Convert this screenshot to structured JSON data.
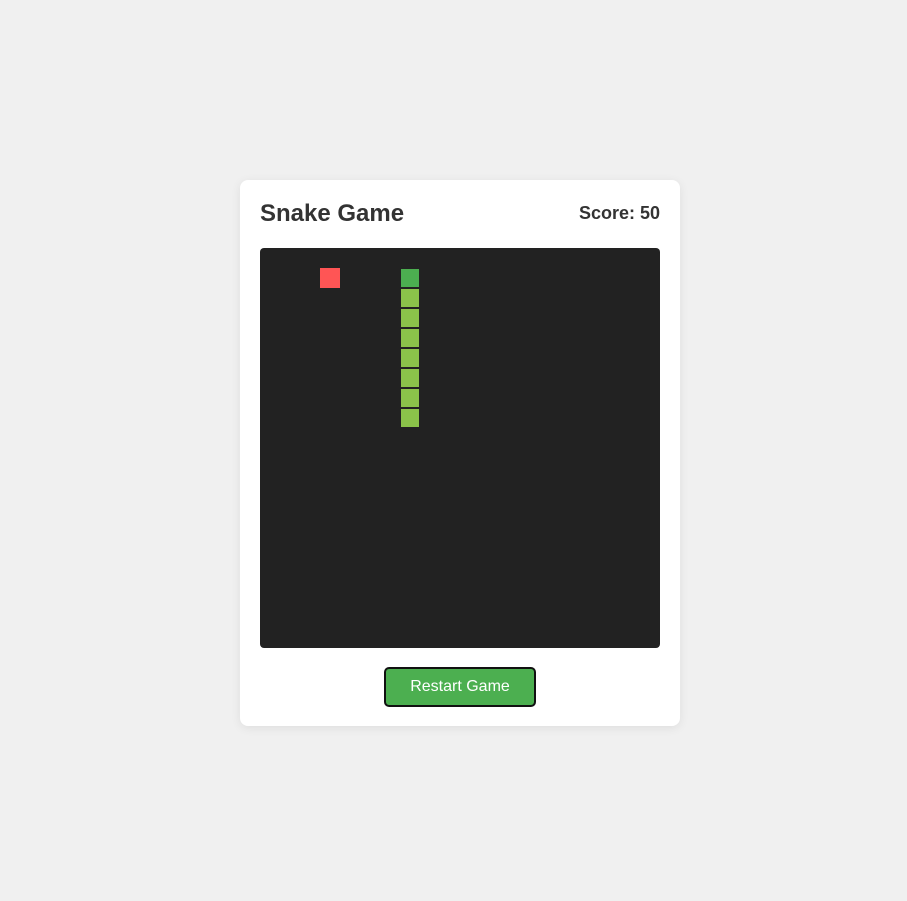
{
  "game": {
    "title": "Snake Game",
    "score_text": "Score: 50",
    "score": 50,
    "restart_label": "Restart Game"
  },
  "board": {
    "cols": 20,
    "rows": 20,
    "background_color": "#222222"
  },
  "food": {
    "col": 3,
    "row": 1,
    "color": "#ff5555"
  },
  "snake": {
    "head_color": "#4caf50",
    "body_color": "#8bc34a",
    "segments": [
      {
        "col": 7,
        "row": 1
      },
      {
        "col": 7,
        "row": 2
      },
      {
        "col": 7,
        "row": 3
      },
      {
        "col": 7,
        "row": 4
      },
      {
        "col": 7,
        "row": 5
      },
      {
        "col": 7,
        "row": 6
      },
      {
        "col": 7,
        "row": 7
      },
      {
        "col": 7,
        "row": 8
      }
    ]
  }
}
